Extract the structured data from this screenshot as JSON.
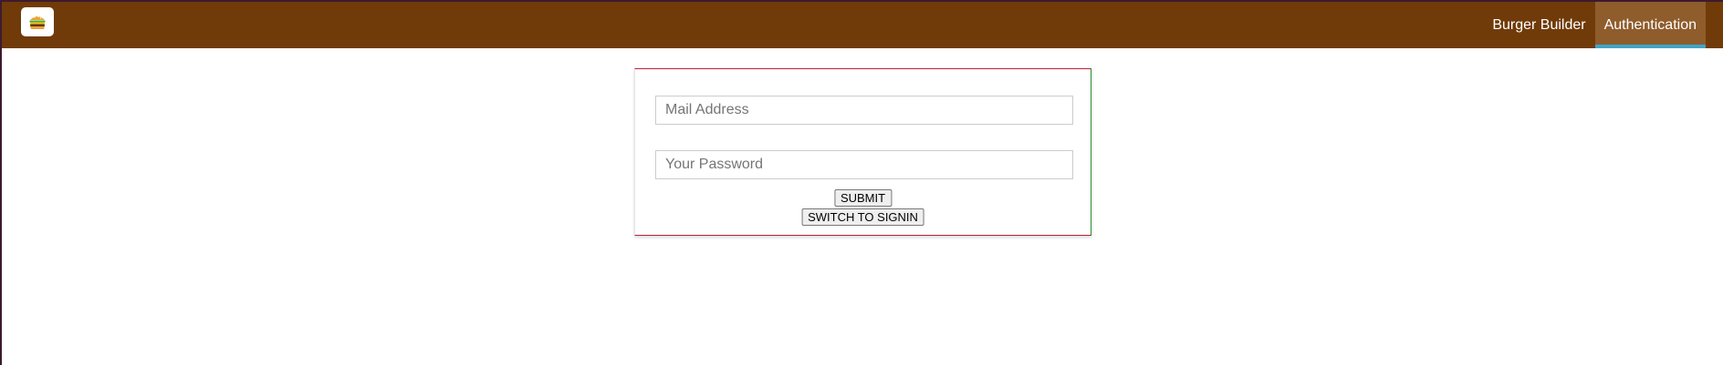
{
  "toolbar": {
    "logo_icon": "burger-logo-icon",
    "colors": {
      "background": "#703B09",
      "active_item": "#8F5C2C",
      "active_indicator": "#40A4C8"
    },
    "nav": [
      {
        "label": "Burger Builder",
        "active": false
      },
      {
        "label": "Authentication",
        "active": true
      }
    ]
  },
  "auth": {
    "email_placeholder": "Mail Address",
    "email_value": "",
    "password_placeholder": "Your Password",
    "password_value": "",
    "submit_label": "SUBMIT",
    "switch_label": "SWITCH TO SIGNIN"
  }
}
